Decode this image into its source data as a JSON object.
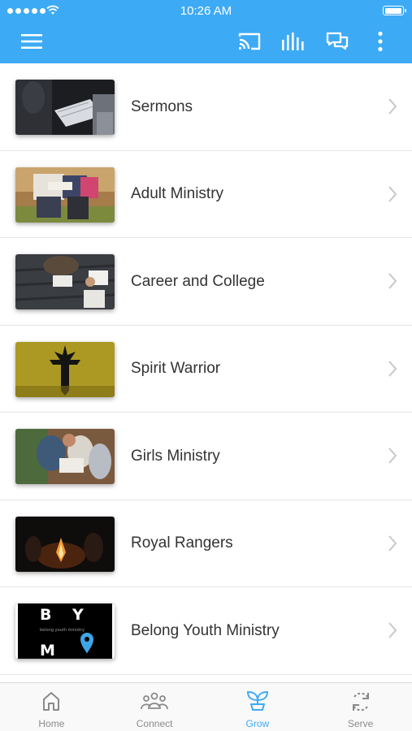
{
  "status_bar": {
    "time": "10:26 AM"
  },
  "toolbar": {
    "menu_icon": "hamburger-menu-icon",
    "cast_icon": "cast-icon",
    "audio_icon": "audio-bars-icon",
    "chat_icon": "chat-bubbles-icon",
    "more_icon": "more-vertical-icon"
  },
  "ministries": [
    {
      "title": "Sermons"
    },
    {
      "title": "Adult Ministry"
    },
    {
      "title": "Career and College"
    },
    {
      "title": "Spirit Warrior"
    },
    {
      "title": "Girls Ministry"
    },
    {
      "title": "Royal Rangers"
    },
    {
      "title": "Belong Youth Ministry"
    }
  ],
  "thumbnail_text": {
    "byim_letters": [
      "B",
      "Y",
      "M"
    ],
    "byim_caption": "belong youth ministry"
  },
  "tabs": [
    {
      "label": "Home",
      "icon": "house-icon",
      "active": false
    },
    {
      "label": "Connect",
      "icon": "people-icon",
      "active": false
    },
    {
      "label": "Grow",
      "icon": "sprout-icon",
      "active": true
    },
    {
      "label": "Serve",
      "icon": "refresh-arrows-icon",
      "active": false
    }
  ],
  "colors": {
    "accent": "#3daaf5",
    "tab_inactive": "#8a8a8a",
    "divider": "#e6e6e6"
  }
}
